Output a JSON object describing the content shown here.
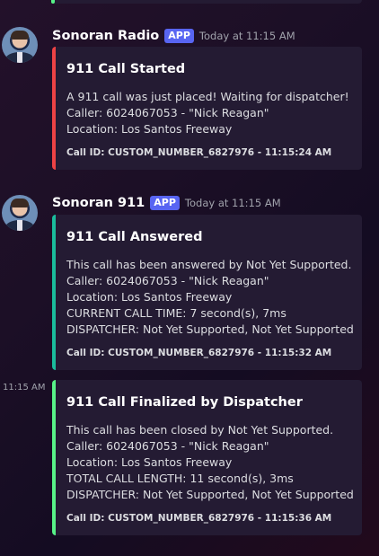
{
  "messages": [
    {
      "author": "Sonoran Radio",
      "tag": "APP",
      "time": "Today at 11:15 AM",
      "embed": {
        "title": "911 Call Started",
        "lines": [
          "A 911 call was just placed! Waiting for dispatcher!",
          "Caller: 6024067053 - \"Nick Reagan\"",
          "Location: Los Santos Freeway"
        ],
        "footer": "Call ID: CUSTOM_NUMBER_6827976 - 11:15:24 AM",
        "color": "#ed4245"
      }
    },
    {
      "author": "Sonoran 911",
      "tag": "APP",
      "time": "Today at 11:15 AM",
      "embed": {
        "title": "911 Call Answered",
        "lines": [
          "This call has been answered by Not Yet Supported.",
          "Caller: 6024067053 - \"Nick Reagan\"",
          "Location: Los Santos Freeway",
          "CURRENT CALL TIME: 7 second(s), 7ms",
          "DISPATCHER: Not Yet Supported, Not Yet Supported"
        ],
        "footer": "Call ID: CUSTOM_NUMBER_6827976 - 11:15:32 AM",
        "color": "#1abc9c"
      }
    },
    {
      "side_time": "11:15 AM",
      "embed": {
        "title": "911 Call Finalized by Dispatcher",
        "lines": [
          "This call has been closed by Not Yet Supported.",
          "Caller: 6024067053 - \"Nick Reagan\"",
          "Location: Los Santos Freeway",
          "TOTAL CALL LENGTH: 11 second(s), 3ms",
          "DISPATCHER: Not Yet Supported, Not Yet Supported"
        ],
        "footer": "Call ID: CUSTOM_NUMBER_6827976 - 11:15:36 AM",
        "color": "#57f287"
      }
    }
  ]
}
